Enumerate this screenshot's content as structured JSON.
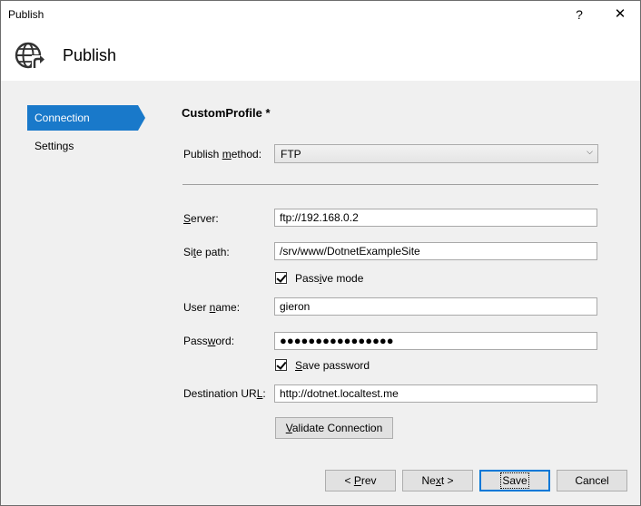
{
  "window": {
    "title": "Publish",
    "help_glyph": "?",
    "close_glyph": "✕"
  },
  "header": {
    "icon": "globe-publish-icon",
    "title": "Publish"
  },
  "sidebar": {
    "items": [
      {
        "label": "Connection",
        "active": true
      },
      {
        "label": "Settings",
        "active": false
      }
    ]
  },
  "profile": {
    "name": "CustomProfile *"
  },
  "form": {
    "publish_method": {
      "label_pre": "Publish ",
      "label_u": "m",
      "label_post": "ethod:",
      "value": "FTP"
    },
    "server": {
      "label_pre": "",
      "label_u": "S",
      "label_post": "erver:",
      "value": "ftp://192.168.0.2"
    },
    "site_path": {
      "label_pre": "Si",
      "label_u": "t",
      "label_post": "e path:",
      "value": "/srv/www/DotnetExampleSite"
    },
    "passive_mode": {
      "label_pre": "Pass",
      "label_u": "i",
      "label_post": "ve mode",
      "checked": true
    },
    "user_name": {
      "label_pre": "User ",
      "label_u": "n",
      "label_post": "ame:",
      "value": "gieron"
    },
    "password": {
      "label_pre": "Pass",
      "label_u": "w",
      "label_post": "ord:",
      "value": "●●●●●●●●●●●●●●●●"
    },
    "save_password": {
      "label_pre": "",
      "label_u": "S",
      "label_post": "ave password",
      "checked": true
    },
    "destination_url": {
      "label_pre": "Destination UR",
      "label_u": "L",
      "label_post": ":",
      "value": "http://dotnet.localtest.me"
    }
  },
  "buttons": {
    "validate": {
      "pre": "",
      "u": "V",
      "post": "alidate Connection"
    },
    "prev": {
      "pre": "< ",
      "u": "P",
      "post": "rev"
    },
    "next": {
      "pre": "Ne",
      "u": "x",
      "post": "t >"
    },
    "save": {
      "label": "Save"
    },
    "cancel": {
      "label": "Cancel"
    }
  }
}
